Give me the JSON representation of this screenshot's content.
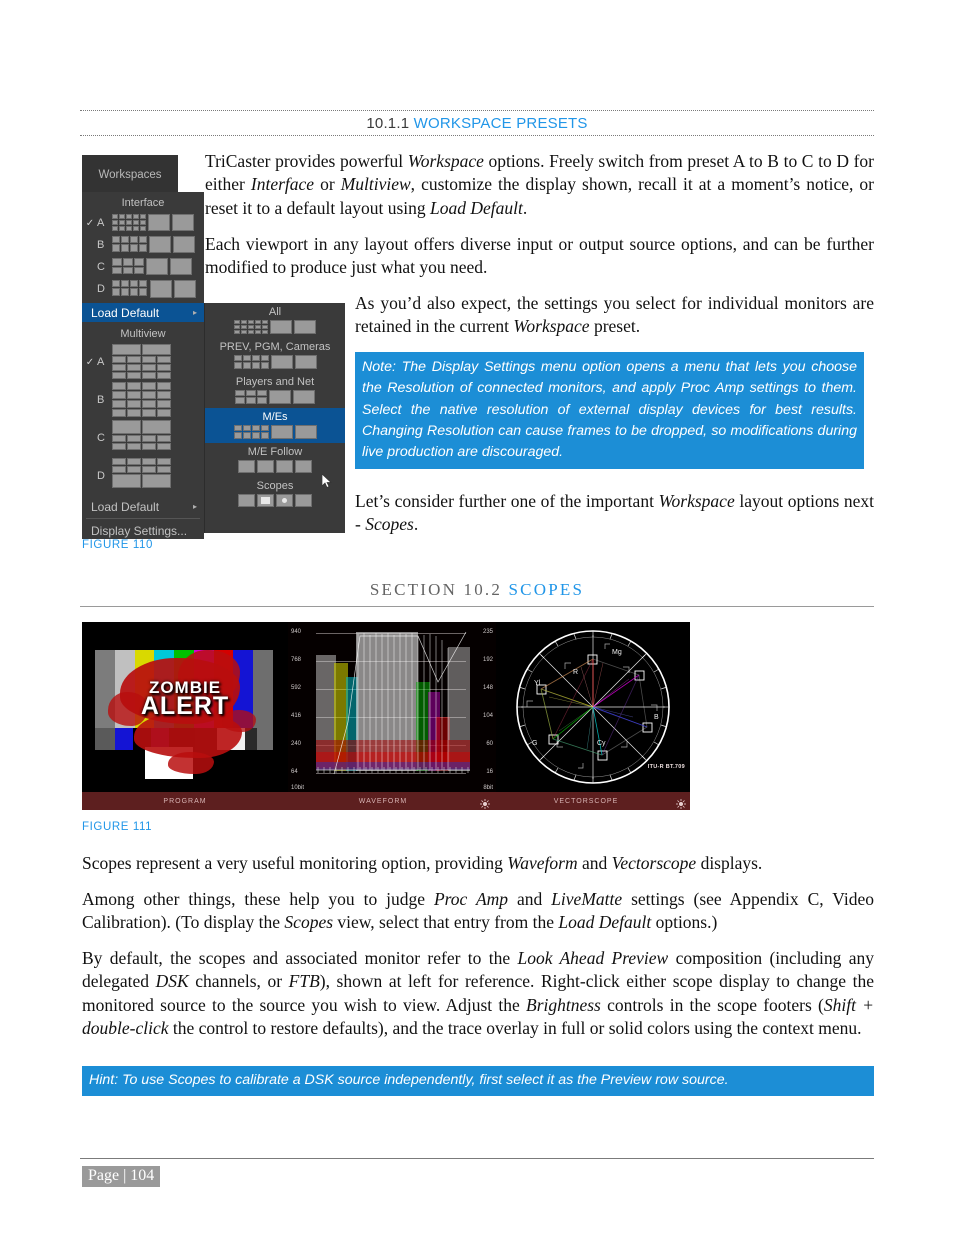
{
  "heading_1011": {
    "number": "10.1.1",
    "title": "WORKSPACE PRESETS"
  },
  "paragraphs": {
    "p1_a": "TriCaster provides powerful ",
    "p1_i1": "Workspace",
    "p1_b": " options.  Freely switch from preset A to B to C to D for either ",
    "p1_i2": "Interface",
    "p1_c": " or ",
    "p1_i3": "Multiview",
    "p1_d": ", customize the display shown, recall it at a moment’s notice, or reset it to a default layout using ",
    "p1_i4": "Load Default",
    "p1_e": ".",
    "p2": "Each viewport in any layout offers diverse input or output source options, and can be further modified to produce just what you need.",
    "p3_a": "As you’d also expect, the settings you select for individual monitors are retained in the current ",
    "p3_i1": "Workspace",
    "p3_b": " preset.",
    "p4_a": "Let’s consider further one of the important ",
    "p4_i1": "Workspace",
    "p4_b": " layout options next - ",
    "p4_i2": "Scopes",
    "p4_c": ".",
    "p5_a": "Scopes represent a very useful monitoring option, providing ",
    "p5_i1": "Waveform",
    "p5_b": " and ",
    "p5_i2": "Vectorscope",
    "p5_c": " displays.",
    "p6_a": "Among other things, these help you to judge ",
    "p6_i1": "Proc Amp",
    "p6_b": " and ",
    "p6_i2": "LiveMatte",
    "p6_c": " settings (see Appendix C, Video Calibration). (To display the ",
    "p6_i3": "Scopes",
    "p6_d": " view, select that entry from the ",
    "p6_i4": "Load Default",
    "p6_e": " options.)",
    "p7_a": "By default, the scopes and associated monitor refer to the ",
    "p7_i1": "Look Ahead Preview",
    "p7_b": " composition (including any delegated ",
    "p7_i2": "DSK",
    "p7_c": " channels, or ",
    "p7_i3": "FTB",
    "p7_d": "), shown at left for reference.  Right-click either scope display to change the monitored source to the source you wish to view.  Adjust the ",
    "p7_i4": "Brightness",
    "p7_e": " controls in the scope footers (",
    "p7_i5": "Shift + double-click",
    "p7_f": " the control to restore defaults), and the trace overlay in full or solid colors using the context menu."
  },
  "note_box": {
    "text": "Note: The Display Settings menu option opens a menu that lets you choose the Resolution of connected monitors, and apply Proc Amp settings to them. Select the native resolution of external display devices for best results. Changing Resolution can cause frames to be dropped, so modifications during live production are discouraged."
  },
  "hint_box": {
    "text": "Hint: To use Scopes to calibrate a DSK source independently, first select it as the Preview row source."
  },
  "figure_110": {
    "caption": "FIGURE 110",
    "tab_label": "Workspaces",
    "interface": {
      "header": "Interface",
      "rows": [
        {
          "check": "✓",
          "letter": "A"
        },
        {
          "check": "",
          "letter": "B"
        },
        {
          "check": "",
          "letter": "C"
        },
        {
          "check": "",
          "letter": "D"
        }
      ],
      "load_default": "Load Default",
      "arrow": "▸"
    },
    "multiview": {
      "header": "Multiview",
      "rows": [
        {
          "check": "✓",
          "letter": "A"
        },
        {
          "check": "",
          "letter": "B"
        },
        {
          "check": "",
          "letter": "C"
        },
        {
          "check": "",
          "letter": "D"
        }
      ],
      "load_default": "Load Default",
      "arrow": "▸",
      "display_settings": "Display Settings..."
    },
    "submenu": {
      "items": [
        {
          "label": "All",
          "selected": false
        },
        {
          "label": "PREV, PGM, Cameras",
          "selected": false
        },
        {
          "label": "Players and Net",
          "selected": false
        },
        {
          "label": "M/Es",
          "selected": true
        },
        {
          "label": "M/E Follow",
          "selected": false
        },
        {
          "label": "Scopes",
          "selected": false
        }
      ]
    },
    "colors": {
      "panel_bg": "#3a3a3a",
      "selected_bg": "#0b5394",
      "text": "#c2c2c2"
    }
  },
  "figure_111": {
    "caption": "FIGURE 111",
    "program": {
      "label": "PROGRAM",
      "overlay_line1": "ZOMBIE",
      "overlay_line2": "ALERT"
    },
    "waveform": {
      "label": "WAVEFORM",
      "left_scale_label": "10bit",
      "right_scale_label": "8bit",
      "left_ticks": [
        "940",
        "768",
        "592",
        "416",
        "240",
        "64"
      ],
      "right_ticks": [
        "235",
        "192",
        "148",
        "104",
        "60",
        "16"
      ]
    },
    "vectorscope": {
      "label": "VECTORSCOPE",
      "standard": "ITU-R BT.709",
      "targets": [
        "R",
        "Mg",
        "B",
        "Cy",
        "G",
        "Yl"
      ]
    },
    "brightness_icon": "brightness-icon"
  },
  "heading_102": {
    "number": "SECTION 10.2",
    "title": "SCOPES"
  },
  "footer": {
    "page_label": "Page | 104"
  },
  "colors": {
    "accent_blue": "#2196e8",
    "callout_blue": "#1c8ed6",
    "heading_gray": "#646464"
  }
}
